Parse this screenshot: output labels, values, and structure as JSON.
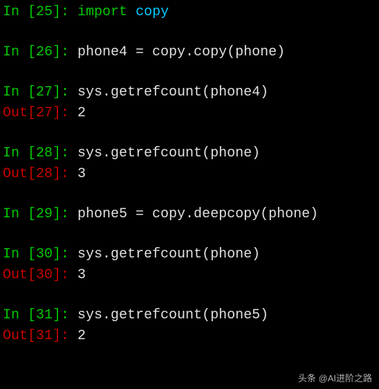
{
  "cells": {
    "c25": {
      "in_prompt": "In [25]: ",
      "kw": "import",
      "sp": " ",
      "mod": "copy"
    },
    "c26": {
      "in_prompt": "In [26]: ",
      "code": "phone4 = copy.copy(phone)"
    },
    "c27": {
      "in_prompt": "In [27]: ",
      "code": "sys.getrefcount(phone4)",
      "out_prompt": "Out[27]: ",
      "result": "2"
    },
    "c28": {
      "in_prompt": "In [28]: ",
      "code": "sys.getrefcount(phone)",
      "out_prompt": "Out[28]: ",
      "result": "3"
    },
    "c29": {
      "in_prompt": "In [29]: ",
      "code": "phone5 = copy.deepcopy(phone)"
    },
    "c30": {
      "in_prompt": "In [30]: ",
      "code": "sys.getrefcount(phone)",
      "out_prompt": "Out[30]: ",
      "result": "3"
    },
    "c31": {
      "in_prompt": "In [31]: ",
      "code": "sys.getrefcount(phone5)",
      "out_prompt": "Out[31]: ",
      "result": "2"
    }
  },
  "watermark": "头条 @AI进阶之路"
}
